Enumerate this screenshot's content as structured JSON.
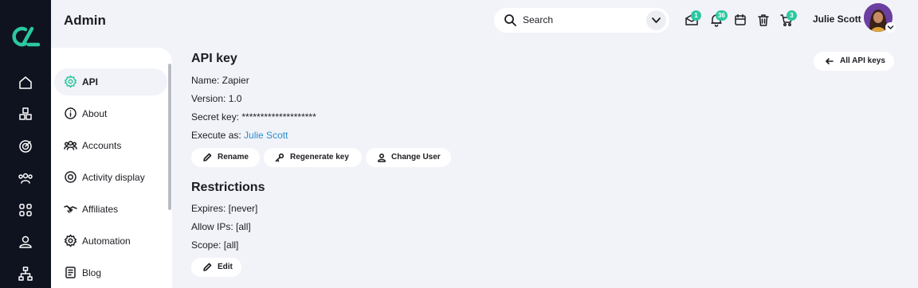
{
  "header": {
    "title": "Admin",
    "search_placeholder": "Search",
    "badges": {
      "messages": "1",
      "notifications": "36",
      "cart": "3"
    },
    "user_name": "Julie Scott"
  },
  "sidebar": {
    "items": [
      {
        "label": "API",
        "icon": "gear-icon",
        "active": true
      },
      {
        "label": "About",
        "icon": "info-icon"
      },
      {
        "label": "Accounts",
        "icon": "users-icon"
      },
      {
        "label": "Activity display",
        "icon": "target-icon"
      },
      {
        "label": "Affiliates",
        "icon": "handshake-icon"
      },
      {
        "label": "Automation",
        "icon": "gear-icon"
      },
      {
        "label": "Blog",
        "icon": "document-icon"
      }
    ]
  },
  "api": {
    "title": "API key",
    "all_keys_label": "All API keys",
    "name_line": "Name: Zapier",
    "version_line": "Version: 1.0",
    "secret_line": "Secret key: ********************",
    "execute_prefix": "Execute as: ",
    "execute_user": "Julie Scott",
    "actions": {
      "rename": "Rename",
      "regenerate": "Regenerate key",
      "change_user": "Change User"
    }
  },
  "restrictions": {
    "title": "Restrictions",
    "expires_line": "Expires: [never]",
    "ips_line": "Allow IPs: [all]",
    "scope_line": "Scope: [all]",
    "edit_label": "Edit"
  },
  "colors": {
    "accent": "#2bc8a0",
    "link": "#2a8fd0",
    "rail": "#0f1320",
    "background": "#f2f3f8"
  }
}
